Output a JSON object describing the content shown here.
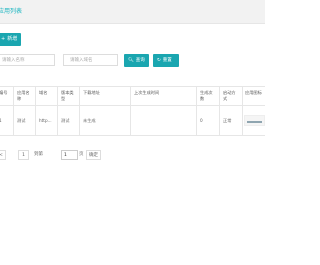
{
  "header": {
    "title": "应用列表"
  },
  "toolbar": {
    "add_label": "新增",
    "add_icon": "plus-icon"
  },
  "filters": {
    "name_placeholder": "请输入名称",
    "domain_placeholder": "请输入域名",
    "search_label": "查询",
    "reset_label": "重置",
    "search_icon": "search-icon",
    "reset_icon": "refresh-icon"
  },
  "table": {
    "columns": [
      "编号",
      "应用名称",
      "域名",
      "版本类型",
      "下载地址",
      "上次生成时间",
      "生成次数",
      "启动方式",
      "应用图标"
    ],
    "rows": [
      {
        "id": "1",
        "name": "测试",
        "domain": "http...",
        "version": "测试",
        "download": "未生成",
        "last_generated": "",
        "count": "0",
        "launch": "正常"
      }
    ]
  },
  "pagination": {
    "prev": "<",
    "current": "1",
    "next": ">",
    "jump_text": "到第",
    "jump_value": "1",
    "page_suffix": "页",
    "confirm": "确定"
  },
  "colors": {
    "accent": "#1aa6b0",
    "title": "#19b5c0",
    "border": "#e6e6e6"
  }
}
